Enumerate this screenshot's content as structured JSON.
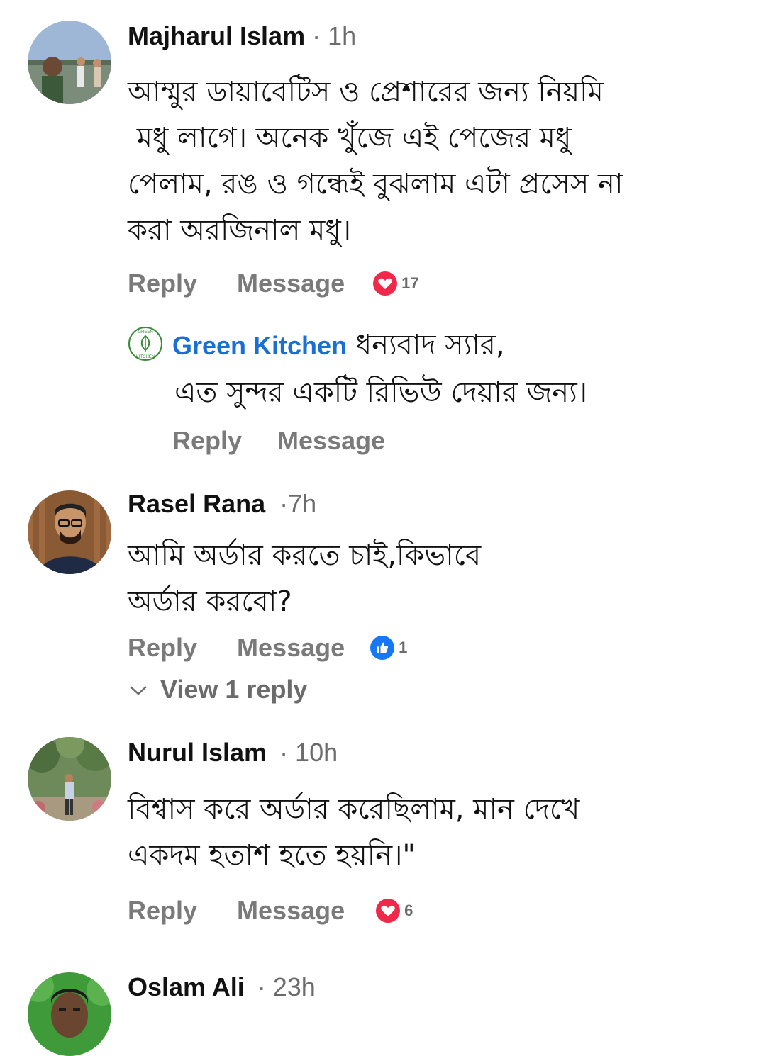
{
  "comments": [
    {
      "author": "Majharul Islam",
      "time": "· 1h",
      "lines": [
        "আম্মুর ডায়াবেটিস ও প্রেশারের জন্য নিয়মি",
        " মধু লাগে। অনেক খুঁজে এই পেজের মধু",
        "পেলাম, রঙ ও গন্ধেই বুঝলাম এটা প্রসেস না",
        "করা অরজিনাল মধু।"
      ],
      "reply_label": "Reply",
      "message_label": "Message",
      "reaction": {
        "type": "love",
        "count": "17",
        "icon": "heart-icon",
        "color": "#f0284a"
      }
    },
    {
      "author": "Rasel Rana",
      "time": "·7h",
      "lines": [
        "আমি অর্ডার করতে চাই,কিভাবে",
        "অর্ডার করবো?"
      ],
      "reply_label": "Reply",
      "message_label": "Message",
      "reaction": {
        "type": "like",
        "count": "1",
        "icon": "thumbs-up-icon",
        "color": "#1877f2"
      },
      "view_replies": "View 1 reply"
    },
    {
      "author": "Nurul Islam",
      "time": "· 10h",
      "lines": [
        "বিশ্বাস করে অর্ডার করেছিলাম, মান দেখে",
        "একদম হতাশ হতে হয়নি।\""
      ],
      "reply_label": "Reply",
      "message_label": "Message",
      "reaction": {
        "type": "love",
        "count": "6",
        "icon": "heart-icon",
        "color": "#f0284a"
      }
    },
    {
      "author": "Oslam Ali",
      "time": "· 23h"
    }
  ],
  "page_reply": {
    "page_name": "Green Kitchen",
    "logo_text_top": "GREEN",
    "logo_text_bottom": "KITCHEN",
    "line1": " ধন্যবাদ স্যার,",
    "line2": "এত সুন্দর একটি রিভিউ দেয়ার জন্য।",
    "reply_label": "Reply",
    "message_label": "Message"
  },
  "colors": {
    "link_blue": "#1a6fd6",
    "love_red": "#f0284a",
    "like_blue": "#1877f2",
    "muted_gray": "#7a7a7a"
  }
}
